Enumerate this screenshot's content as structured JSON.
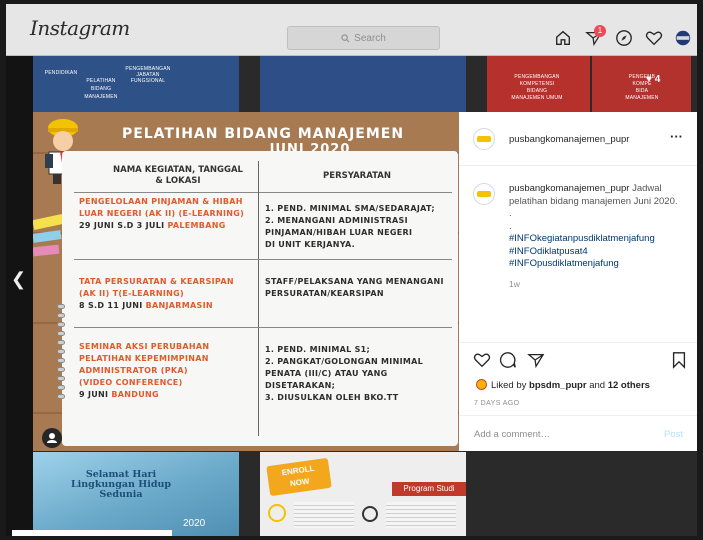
{
  "app": {
    "logo": "Instagram"
  },
  "search": {
    "placeholder": "Search"
  },
  "nav": {
    "notification_count": "1"
  },
  "bg_tiles": {
    "tile1": [
      "PENDIDIKAN",
      "PELATIHAN",
      "PENGEMBANGAN",
      "JABATAN",
      "BIDANG",
      "FUNGSIONAL",
      "MANAJEMEN"
    ],
    "tile3": [
      "PENGEMBANGAN",
      "KOMPETENSI",
      "BIDANG",
      "MANAJEMEN UMUM"
    ],
    "tile4": [
      "PENGEMB",
      "KOMPE",
      "BIDA",
      "MANAJEMEN"
    ],
    "like_count": "4",
    "bottom1": [
      "Selamat Hari",
      "Lingkungan Hidup",
      "Sedunia",
      "2020"
    ],
    "bottom2": [
      "ENROLL",
      "NOW",
      "Program Studi"
    ]
  },
  "post": {
    "banner_line1": "PELATIHAN BIDANG MANAJEMEN",
    "banner_line2": "JUNI 2020",
    "header_col1": [
      "NAMA KEGIATAN, TANGGAL",
      "& LOKASI"
    ],
    "header_col2": "PERSYARATAN",
    "rows": [
      {
        "name": [
          "PENGELOLAAN PINJAMAN & HIBAH",
          "LUAR NEGERI (AK II) (E-LEARNING)"
        ],
        "date": "29 JUNI S.D 3 JULI ",
        "city": "PALEMBANG",
        "req": [
          "1. PEND. MINIMAL SMA/SEDARAJAT;",
          "2. MENANGANI ADMINISTRASI",
          "PINJAMAN/HIBAH LUAR NEGERI",
          "DI UNIT KERJANYA."
        ]
      },
      {
        "name": [
          "TATA PERSURATAN & KEARSIPAN",
          "(AK II) T(E-LEARNING)"
        ],
        "date": "8 S.D 11 JUNI ",
        "city": "BANJARMASIN",
        "req": [
          "STAFF/PELAKSANA YANG MENANGANI",
          "PERSURATAN/KEARSIPAN"
        ]
      },
      {
        "name": [
          "SEMINAR AKSI PERUBAHAN",
          "PELATIHAN KEPEMIMPINAN",
          "ADMINISTRATOR (PKA)",
          "(VIDEO CONFERENCE)"
        ],
        "date": "9 JUNI ",
        "city": "BANDUNG",
        "req": [
          "1. PEND. MINIMAL S1;",
          "2. PANGKAT/GOLONGAN MINIMAL",
          "PENATA (III/C) ATAU YANG",
          "DISETARAKAN;",
          "3. DIUSULKAN OLEH BKO.TT"
        ]
      }
    ]
  },
  "panel": {
    "username": "pusbangkomanajemen_pupr",
    "caption_user": "pusbangkomanajemen_pupr",
    "caption_text": "Jadwal pelatihan bidang manajemen Juni 2020.",
    "dots": [
      ".",
      "."
    ],
    "hashtags": [
      "#INFOkegiatanpusdiklatmenjafung",
      "#INFOdiklatpusat4",
      "#INFOpusdiklatmenjafung"
    ],
    "caption_time": "1w",
    "liked_prefix": "Liked by ",
    "liked_user": "bpsdm_pupr",
    "liked_and": " and ",
    "liked_others": "12 others",
    "ago": "7 DAYS AGO",
    "comment_placeholder": "Add a comment…",
    "post_label": "Post"
  },
  "colors": {
    "accent_red": "#e05a2a",
    "hashtag": "#00376b",
    "post_btn": "#b2dffc"
  }
}
